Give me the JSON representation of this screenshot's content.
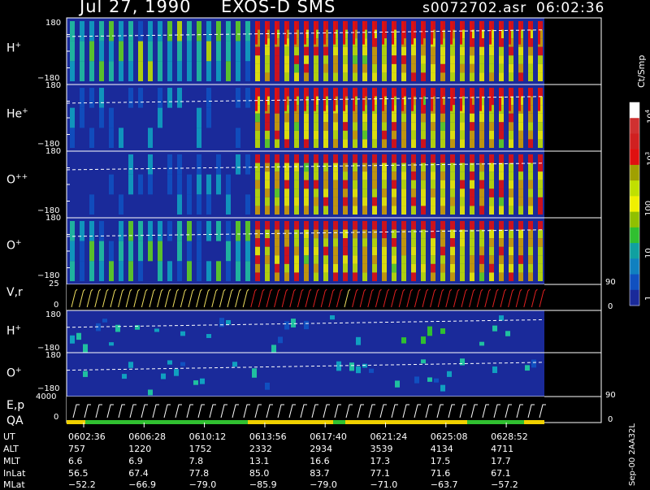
{
  "header": {
    "date": "Jul 27, 1990",
    "instrument": "EXOS-D SMS",
    "filename": "s0072702.asr",
    "time": "06:02:36"
  },
  "colorbar": {
    "unit": "Ct/Smp",
    "tick_labels": [
      "1",
      "10",
      "100",
      "10",
      "10"
    ],
    "tick_exponents": [
      "",
      "",
      "",
      "3",
      "4"
    ],
    "tick_values": [
      1,
      10,
      100,
      1000,
      10000
    ]
  },
  "panels": {
    "p1": {
      "ion": "H",
      "charge": "+",
      "ymax": "180",
      "ymin": "−180"
    },
    "p2": {
      "ion": "He",
      "charge": "+",
      "ymax": "180",
      "ymin": "−180"
    },
    "p3": {
      "ion": "O",
      "charge": "++",
      "ymax": "180",
      "ymin": "−180"
    },
    "p4": {
      "ion": "O",
      "charge": "+",
      "ymax": "180",
      "ymin": "−180"
    },
    "p5": {
      "label": "V,r",
      "ymax": "25",
      "ymin": "0",
      "rmax": "90",
      "rmin": "0"
    },
    "p6": {
      "ion": "H",
      "charge": "+",
      "ymax": "180",
      "ymin": "−180"
    },
    "p7": {
      "ion": "O",
      "charge": "+",
      "ymax": "180",
      "ymin": "−180"
    },
    "p8": {
      "label1": "E,p",
      "label2": "QA",
      "ymax": "4000",
      "ymin": "0",
      "rmax": "90",
      "rmin": "0"
    }
  },
  "ephemeris": {
    "labels": [
      "UT",
      "ALT",
      "MLT",
      "InLat",
      "MLat"
    ],
    "ut": [
      "0602:36",
      "0606:28",
      "0610:12",
      "0613:56",
      "0617:40",
      "0621:24",
      "0625:08",
      "0628:52"
    ],
    "alt": [
      "757",
      "1220",
      "1752",
      "2332",
      "2934",
      "3539",
      "4134",
      "4711"
    ],
    "mlt": [
      "6.6",
      "6.9",
      "7.8",
      "13.1",
      "16.6",
      "17.3",
      "17.5",
      "17.7"
    ],
    "inlat": [
      "56.5",
      "67.4",
      "77.8",
      "85.0",
      "83.7",
      "77.1",
      "71.6",
      "67.1"
    ],
    "mlat": [
      "−52.2",
      "−66.9",
      "−79.0",
      "−85.9",
      "−79.0",
      "−71.0",
      "−63.7",
      "−57.2"
    ]
  },
  "side_note": "Sep-00  2AA32L",
  "chart_data": {
    "type": "heatmap",
    "x_axis": "UT",
    "x_ticks": [
      "0602:36",
      "0606:28",
      "0610:12",
      "0613:56",
      "0617:40",
      "0621:24",
      "0625:08",
      "0628:52"
    ],
    "y_range_pitch": [
      -180,
      180
    ],
    "color_scale": "log",
    "color_range": [
      1,
      10000
    ],
    "colors": {
      "background": "#000000",
      "low": "#1a2a9a",
      "accent_red": "#e01010",
      "accent_yellow": "#f0f000",
      "accent_green": "#30c030",
      "white": "#ffffff"
    },
    "velocity_panel": {
      "ylim": [
        0,
        25
      ],
      "right_ylim": [
        0,
        90
      ]
    },
    "energy_panel": {
      "ylim": [
        0,
        4000
      ],
      "right_ylim": [
        0,
        90
      ]
    }
  }
}
